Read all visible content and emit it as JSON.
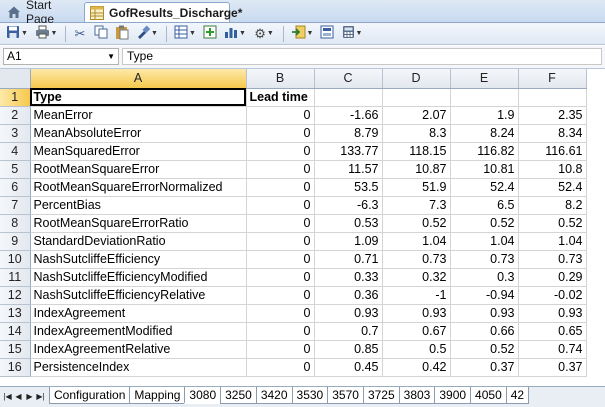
{
  "tabs": {
    "start_page": "Start Page",
    "active_doc": "GofResults_Discharge*"
  },
  "formula_bar": {
    "name_box": "A1",
    "content": "Type"
  },
  "columns": [
    "A",
    "B",
    "C",
    "D",
    "E",
    "F"
  ],
  "header_row": [
    "Type",
    "Lead time",
    "",
    "",
    "",
    ""
  ],
  "rows": [
    {
      "n": "2",
      "cells": [
        "MeanError",
        "0",
        "-1.66",
        "2.07",
        "1.9",
        "2.35"
      ]
    },
    {
      "n": "3",
      "cells": [
        "MeanAbsoluteError",
        "0",
        "8.79",
        "8.3",
        "8.24",
        "8.34"
      ]
    },
    {
      "n": "4",
      "cells": [
        "MeanSquaredError",
        "0",
        "133.77",
        "118.15",
        "116.82",
        "116.61"
      ]
    },
    {
      "n": "5",
      "cells": [
        "RootMeanSquareError",
        "0",
        "11.57",
        "10.87",
        "10.81",
        "10.8"
      ]
    },
    {
      "n": "6",
      "cells": [
        "RootMeanSquareErrorNormalized",
        "0",
        "53.5",
        "51.9",
        "52.4",
        "52.4"
      ]
    },
    {
      "n": "7",
      "cells": [
        "PercentBias",
        "0",
        "-6.3",
        "7.3",
        "6.5",
        "8.2"
      ]
    },
    {
      "n": "8",
      "cells": [
        "RootMeanSquareErrorRatio",
        "0",
        "0.53",
        "0.52",
        "0.52",
        "0.52"
      ]
    },
    {
      "n": "9",
      "cells": [
        "StandardDeviationRatio",
        "0",
        "1.09",
        "1.04",
        "1.04",
        "1.04"
      ]
    },
    {
      "n": "10",
      "cells": [
        "NashSutcliffeEfficiency",
        "0",
        "0.71",
        "0.73",
        "0.73",
        "0.73"
      ]
    },
    {
      "n": "11",
      "cells": [
        "NashSutcliffeEfficiencyModified",
        "0",
        "0.33",
        "0.32",
        "0.3",
        "0.29"
      ]
    },
    {
      "n": "12",
      "cells": [
        "NashSutcliffeEfficiencyRelative",
        "0",
        "0.36",
        "-1",
        "-0.94",
        "-0.02"
      ]
    },
    {
      "n": "13",
      "cells": [
        "IndexAgreement",
        "0",
        "0.93",
        "0.93",
        "0.93",
        "0.93"
      ]
    },
    {
      "n": "14",
      "cells": [
        "IndexAgreementModified",
        "0",
        "0.7",
        "0.67",
        "0.66",
        "0.65"
      ]
    },
    {
      "n": "15",
      "cells": [
        "IndexAgreementRelative",
        "0",
        "0.85",
        "0.5",
        "0.52",
        "0.74"
      ]
    },
    {
      "n": "16",
      "cells": [
        "PersistenceIndex",
        "0",
        "0.45",
        "0.42",
        "0.37",
        "0.37"
      ]
    }
  ],
  "sheet_tabs": [
    "Configuration",
    "Mapping",
    "3080",
    "3250",
    "3420",
    "3530",
    "3570",
    "3725",
    "3803",
    "3900",
    "4050",
    "42"
  ],
  "active_sheet": "3080",
  "icons": [
    "home-icon",
    "spreadsheet-icon",
    "save-icon",
    "print-icon",
    "cut-icon",
    "copy-icon",
    "paste-icon",
    "format-painter-icon",
    "table-icon",
    "insert-icon",
    "chart-icon",
    "settings-icon",
    "import-icon",
    "export-icon",
    "calculator-icon"
  ]
}
